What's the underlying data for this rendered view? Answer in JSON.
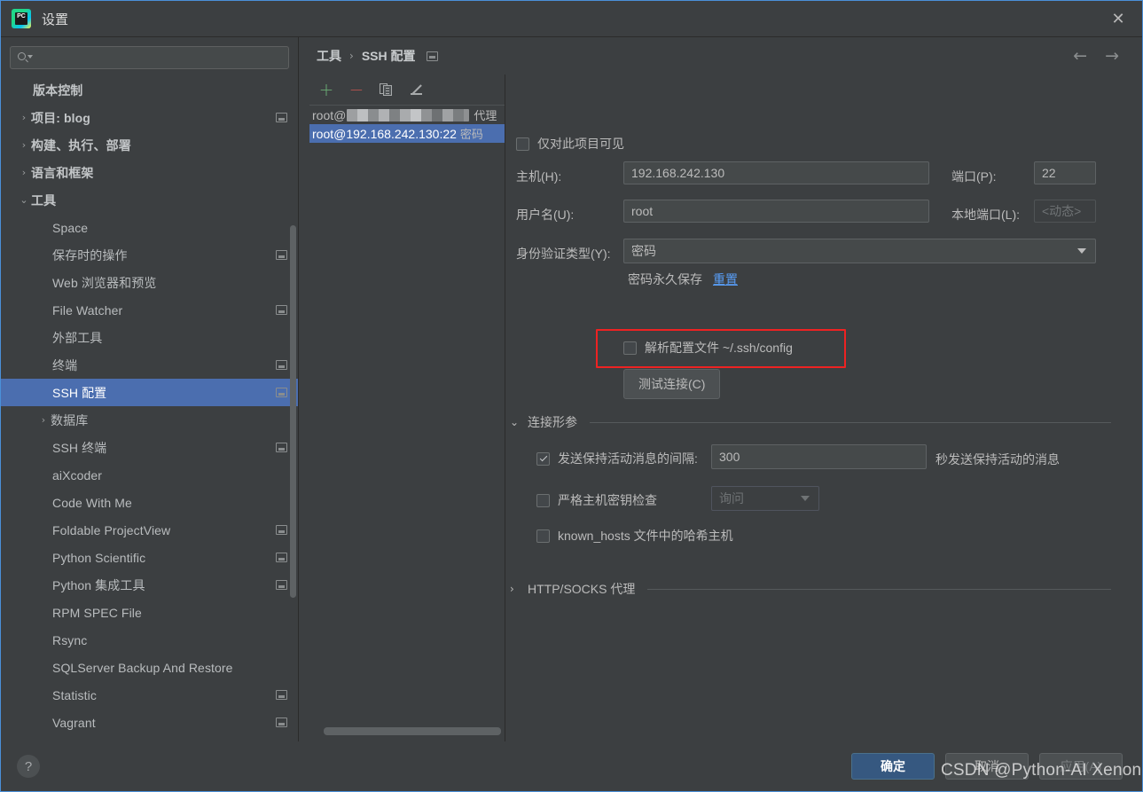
{
  "window": {
    "title": "设置",
    "close_label": "✕",
    "app_icon_text": "PC"
  },
  "sidebar": {
    "search": {
      "value": "",
      "placeholder": ""
    },
    "items": [
      {
        "label": "版本控制",
        "arrow": "",
        "bold": true,
        "indent": 18,
        "badge": false,
        "selected": false
      },
      {
        "label": "项目: blog",
        "arrow": "›",
        "bold": true,
        "indent": 0,
        "badge": true,
        "selected": false
      },
      {
        "label": "构建、执行、部署",
        "arrow": "›",
        "bold": true,
        "indent": 0,
        "badge": false,
        "selected": false
      },
      {
        "label": "语言和框架",
        "arrow": "›",
        "bold": true,
        "indent": 0,
        "badge": false,
        "selected": false
      },
      {
        "label": "工具",
        "arrow": "⌄",
        "bold": true,
        "indent": 0,
        "badge": false,
        "selected": false
      },
      {
        "label": "Space",
        "arrow": "",
        "bold": false,
        "indent": 40,
        "badge": false,
        "selected": false
      },
      {
        "label": "保存时的操作",
        "arrow": "",
        "bold": false,
        "indent": 40,
        "badge": true,
        "selected": false
      },
      {
        "label": "Web 浏览器和预览",
        "arrow": "",
        "bold": false,
        "indent": 40,
        "badge": false,
        "selected": false
      },
      {
        "label": "File Watcher",
        "arrow": "",
        "bold": false,
        "indent": 40,
        "badge": true,
        "selected": false
      },
      {
        "label": "外部工具",
        "arrow": "",
        "bold": false,
        "indent": 40,
        "badge": false,
        "selected": false
      },
      {
        "label": "终端",
        "arrow": "",
        "bold": false,
        "indent": 40,
        "badge": true,
        "selected": false
      },
      {
        "label": "SSH 配置",
        "arrow": "",
        "bold": false,
        "indent": 40,
        "badge": true,
        "selected": true
      },
      {
        "label": "数据库",
        "arrow": "›",
        "bold": false,
        "indent": 22,
        "badge": false,
        "selected": false
      },
      {
        "label": "SSH 终端",
        "arrow": "",
        "bold": false,
        "indent": 40,
        "badge": true,
        "selected": false
      },
      {
        "label": "aiXcoder",
        "arrow": "",
        "bold": false,
        "indent": 40,
        "badge": false,
        "selected": false
      },
      {
        "label": "Code With Me",
        "arrow": "",
        "bold": false,
        "indent": 40,
        "badge": false,
        "selected": false
      },
      {
        "label": "Foldable ProjectView",
        "arrow": "",
        "bold": false,
        "indent": 40,
        "badge": true,
        "selected": false
      },
      {
        "label": "Python Scientific",
        "arrow": "",
        "bold": false,
        "indent": 40,
        "badge": true,
        "selected": false
      },
      {
        "label": "Python 集成工具",
        "arrow": "",
        "bold": false,
        "indent": 40,
        "badge": true,
        "selected": false
      },
      {
        "label": "RPM SPEC File",
        "arrow": "",
        "bold": false,
        "indent": 40,
        "badge": false,
        "selected": false
      },
      {
        "label": "Rsync",
        "arrow": "",
        "bold": false,
        "indent": 40,
        "badge": false,
        "selected": false
      },
      {
        "label": "SQLServer Backup And Restore",
        "arrow": "",
        "bold": false,
        "indent": 40,
        "badge": false,
        "selected": false
      },
      {
        "label": "Statistic",
        "arrow": "",
        "bold": false,
        "indent": 40,
        "badge": true,
        "selected": false
      },
      {
        "label": "Vagrant",
        "arrow": "",
        "bold": false,
        "indent": 40,
        "badge": true,
        "selected": false
      }
    ]
  },
  "breadcrumb": {
    "parent": "工具",
    "separator": "›",
    "current": "SSH 配置"
  },
  "nav": {
    "back": "←",
    "forward": "→"
  },
  "list_pane": {
    "toolbar": {
      "add": "+",
      "remove": "−",
      "copy": "copy-icon",
      "edit": "edit-icon"
    },
    "items": [
      {
        "prefix": "root@",
        "masked": true,
        "suffix": "代理",
        "selected": false
      },
      {
        "prefix": "root@192.168.242.130:22",
        "masked": false,
        "suffix": "密码",
        "selected": true
      }
    ]
  },
  "form": {
    "visible_only_checkbox": {
      "label": "仅对此项目可见",
      "checked": false
    },
    "host": {
      "label": "主机(H):",
      "value": "192.168.242.130"
    },
    "port": {
      "label": "端口(P):",
      "value": "22"
    },
    "username": {
      "label": "用户名(U):",
      "value": "root"
    },
    "local_port": {
      "label": "本地端口(L):",
      "value": "<动态>",
      "disabled": true
    },
    "auth_type": {
      "label": "身份验证类型(Y):",
      "value": "密码"
    },
    "password_saved_text": "密码永久保存",
    "reset_link": "重置",
    "parse_config": {
      "label": "解析配置文件 ~/.ssh/config",
      "checked": false,
      "highlight_color": "#ee2222"
    },
    "test_connection_button": "测试连接(C)"
  },
  "connection_section": {
    "title": "连接形参",
    "arrow": "⌄",
    "keepalive": {
      "label": "发送保持活动消息的间隔:",
      "checked": true,
      "value": "300",
      "suffix": "秒发送保持活动的消息"
    },
    "strict_host_key": {
      "label": "严格主机密钥检查",
      "checked": false,
      "select_value": "询问",
      "disabled": true
    },
    "hash_known_hosts": {
      "label": "known_hosts 文件中的哈希主机",
      "checked": false
    }
  },
  "proxy_section": {
    "title": "HTTP/SOCKS 代理",
    "arrow": "›"
  },
  "footer": {
    "help": "?",
    "ok": "确定",
    "cancel": "取消",
    "apply": "应用(A)"
  },
  "watermark": "CSDN @Python-AI Xenon"
}
